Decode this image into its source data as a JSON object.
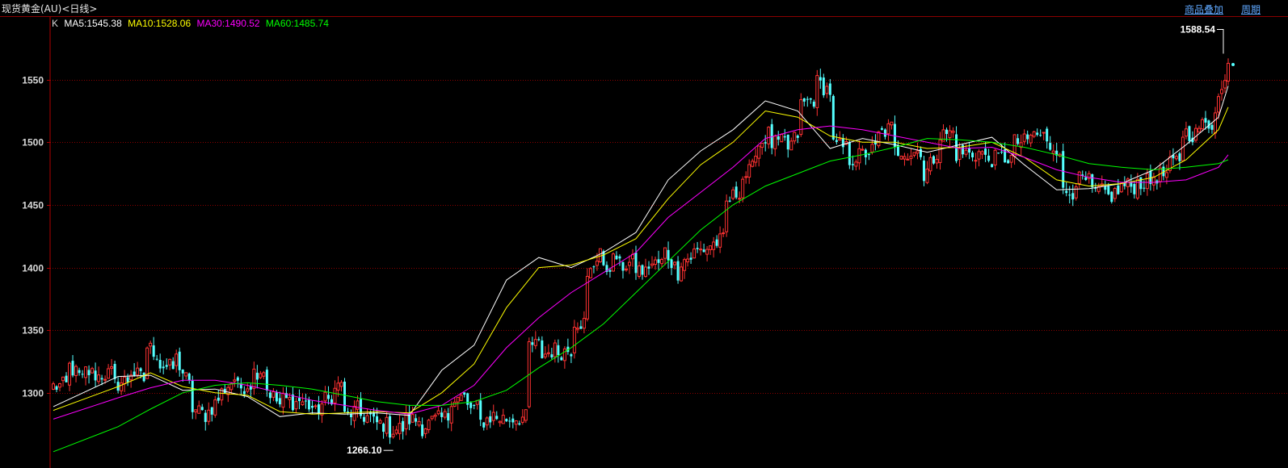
{
  "window": {
    "title": "现货黄金(AU)<日线>",
    "links": [
      "商品叠加",
      "周期"
    ]
  },
  "legend": {
    "k": "K",
    "items": [
      {
        "text": "MA5:1545.38",
        "color": "#ffffff"
      },
      {
        "text": "MA10:1528.06",
        "color": "#ffff00"
      },
      {
        "text": "MA30:1490.52",
        "color": "#ff00ff"
      },
      {
        "text": "MA60:1485.74",
        "color": "#00ff00"
      }
    ]
  },
  "colors": {
    "up": "#ff3232",
    "down": "#54ffff",
    "grid": "#8b0000",
    "axis": "#b00000",
    "label": "#d8d8d8"
  },
  "chart_data": {
    "type": "candlestick",
    "ylim": [
      1240,
      1600
    ],
    "yticks": [
      1300,
      1350,
      1400,
      1450,
      1500,
      1550
    ],
    "annotations": [
      {
        "text": "1588.54",
        "kind": "high"
      },
      {
        "text": "1266.10",
        "kind": "low"
      }
    ],
    "ohlc_anchors": [
      [
        1282,
        1305
      ],
      [
        1306,
        1322
      ],
      [
        1309,
        1318
      ],
      [
        1313,
        1314
      ],
      [
        1316,
        1306
      ],
      [
        1311,
        1318
      ],
      [
        1310,
        1338
      ],
      [
        1330,
        1322
      ],
      [
        1319,
        1329
      ],
      [
        1303,
        1288
      ],
      [
        1282,
        1282
      ],
      [
        1298,
        1300
      ],
      [
        1313,
        1303
      ],
      [
        1308,
        1316
      ],
      [
        1320,
        1303
      ],
      [
        1288,
        1295
      ],
      [
        1292,
        1295
      ],
      [
        1288,
        1280
      ],
      [
        1298,
        1293
      ],
      [
        1312,
        1280
      ],
      [
        1287,
        1282
      ],
      [
        1280,
        1276
      ],
      [
        1274,
        1270
      ],
      [
        1272,
        1279
      ],
      [
        1278,
        1271
      ],
      [
        1278,
        1278
      ],
      [
        1281,
        1296
      ],
      [
        1296,
        1288
      ],
      [
        1288,
        1276
      ],
      [
        1283,
        1280
      ],
      [
        1279,
        1280
      ],
      [
        1280,
        1338
      ],
      [
        1338,
        1330
      ],
      [
        1335,
        1332
      ],
      [
        1335,
        1358
      ],
      [
        1355,
        1390
      ],
      [
        1420,
        1395
      ],
      [
        1410,
        1400
      ],
      [
        1404,
        1400
      ],
      [
        1395,
        1402
      ],
      [
        1404,
        1415
      ],
      [
        1395,
        1405
      ],
      [
        1409,
        1412
      ],
      [
        1416,
        1418
      ],
      [
        1422,
        1450
      ],
      [
        1462,
        1470
      ],
      [
        1480,
        1495
      ],
      [
        1508,
        1498
      ],
      [
        1500,
        1492
      ],
      [
        1510,
        1530
      ],
      [
        1535,
        1548
      ],
      [
        1540,
        1498
      ],
      [
        1495,
        1485
      ],
      [
        1490,
        1490
      ],
      [
        1495,
        1505
      ],
      [
        1512,
        1492
      ],
      [
        1495,
        1490
      ],
      [
        1495,
        1470
      ],
      [
        1495,
        1505
      ],
      [
        1508,
        1490
      ],
      [
        1492,
        1490
      ],
      [
        1492,
        1486
      ],
      [
        1487,
        1488
      ],
      [
        1487,
        1500
      ],
      [
        1500,
        1506
      ],
      [
        1505,
        1498
      ],
      [
        1495,
        1458
      ],
      [
        1462,
        1470
      ],
      [
        1468,
        1460
      ],
      [
        1460,
        1455
      ],
      [
        1462,
        1465
      ],
      [
        1465,
        1468
      ],
      [
        1468,
        1473
      ],
      [
        1474,
        1480
      ],
      [
        1488,
        1508
      ],
      [
        1506,
        1512
      ],
      [
        1515,
        1525
      ],
      [
        1553,
        1563
      ]
    ],
    "ma_anchors": {
      "MA5": [
        [
          0,
          1289
        ],
        [
          20,
          1313
        ],
        [
          30,
          1314
        ],
        [
          40,
          1302
        ],
        [
          50,
          1303
        ],
        [
          60,
          1297
        ],
        [
          70,
          1281
        ],
        [
          80,
          1284
        ],
        [
          90,
          1283
        ],
        [
          100,
          1284
        ],
        [
          110,
          1282
        ],
        [
          120,
          1318
        ],
        [
          130,
          1338
        ],
        [
          140,
          1390
        ],
        [
          150,
          1408
        ],
        [
          160,
          1400
        ],
        [
          170,
          1412
        ],
        [
          180,
          1428
        ],
        [
          190,
          1470
        ],
        [
          200,
          1493
        ],
        [
          210,
          1510
        ],
        [
          220,
          1533
        ],
        [
          230,
          1525
        ],
        [
          240,
          1495
        ],
        [
          250,
          1503
        ],
        [
          260,
          1498
        ],
        [
          270,
          1492
        ],
        [
          280,
          1498
        ],
        [
          290,
          1504
        ],
        [
          300,
          1482
        ],
        [
          310,
          1462
        ],
        [
          320,
          1463
        ],
        [
          330,
          1467
        ],
        [
          340,
          1478
        ],
        [
          350,
          1498
        ],
        [
          360,
          1520
        ],
        [
          363,
          1545
        ]
      ],
      "MA10": [
        [
          0,
          1286
        ],
        [
          20,
          1305
        ],
        [
          30,
          1316
        ],
        [
          40,
          1305
        ],
        [
          50,
          1300
        ],
        [
          60,
          1298
        ],
        [
          70,
          1285
        ],
        [
          80,
          1283
        ],
        [
          90,
          1284
        ],
        [
          100,
          1285
        ],
        [
          110,
          1284
        ],
        [
          120,
          1300
        ],
        [
          130,
          1323
        ],
        [
          140,
          1368
        ],
        [
          150,
          1400
        ],
        [
          160,
          1402
        ],
        [
          170,
          1410
        ],
        [
          180,
          1423
        ],
        [
          190,
          1455
        ],
        [
          200,
          1482
        ],
        [
          210,
          1500
        ],
        [
          220,
          1525
        ],
        [
          230,
          1520
        ],
        [
          240,
          1505
        ],
        [
          250,
          1500
        ],
        [
          260,
          1500
        ],
        [
          270,
          1495
        ],
        [
          280,
          1496
        ],
        [
          290,
          1500
        ],
        [
          300,
          1488
        ],
        [
          310,
          1470
        ],
        [
          320,
          1465
        ],
        [
          330,
          1467
        ],
        [
          340,
          1472
        ],
        [
          350,
          1486
        ],
        [
          360,
          1510
        ],
        [
          363,
          1528
        ]
      ],
      "MA30": [
        [
          0,
          1279
        ],
        [
          20,
          1296
        ],
        [
          30,
          1304
        ],
        [
          40,
          1310
        ],
        [
          50,
          1310
        ],
        [
          60,
          1306
        ],
        [
          70,
          1300
        ],
        [
          80,
          1294
        ],
        [
          90,
          1290
        ],
        [
          100,
          1286
        ],
        [
          110,
          1283
        ],
        [
          120,
          1290
        ],
        [
          130,
          1306
        ],
        [
          140,
          1336
        ],
        [
          150,
          1360
        ],
        [
          160,
          1380
        ],
        [
          170,
          1396
        ],
        [
          180,
          1412
        ],
        [
          190,
          1440
        ],
        [
          200,
          1460
        ],
        [
          210,
          1480
        ],
        [
          220,
          1503
        ],
        [
          230,
          1510
        ],
        [
          240,
          1513
        ],
        [
          250,
          1510
        ],
        [
          260,
          1505
        ],
        [
          270,
          1500
        ],
        [
          280,
          1495
        ],
        [
          290,
          1496
        ],
        [
          300,
          1488
        ],
        [
          310,
          1478
        ],
        [
          320,
          1472
        ],
        [
          330,
          1468
        ],
        [
          340,
          1468
        ],
        [
          350,
          1470
        ],
        [
          360,
          1480
        ],
        [
          363,
          1490
        ]
      ],
      "MA60": [
        [
          0,
          1253
        ],
        [
          20,
          1273
        ],
        [
          30,
          1287
        ],
        [
          40,
          1300
        ],
        [
          50,
          1306
        ],
        [
          60,
          1308
        ],
        [
          70,
          1306
        ],
        [
          80,
          1303
        ],
        [
          90,
          1298
        ],
        [
          100,
          1293
        ],
        [
          110,
          1290
        ],
        [
          120,
          1290
        ],
        [
          130,
          1293
        ],
        [
          140,
          1302
        ],
        [
          150,
          1320
        ],
        [
          160,
          1336
        ],
        [
          170,
          1355
        ],
        [
          180,
          1380
        ],
        [
          190,
          1405
        ],
        [
          200,
          1430
        ],
        [
          210,
          1450
        ],
        [
          220,
          1465
        ],
        [
          230,
          1475
        ],
        [
          240,
          1485
        ],
        [
          250,
          1490
        ],
        [
          260,
          1496
        ],
        [
          270,
          1503
        ],
        [
          280,
          1502
        ],
        [
          290,
          1500
        ],
        [
          300,
          1496
        ],
        [
          310,
          1490
        ],
        [
          320,
          1483
        ],
        [
          330,
          1480
        ],
        [
          340,
          1478
        ],
        [
          350,
          1480
        ],
        [
          360,
          1483
        ],
        [
          363,
          1486
        ]
      ]
    },
    "count": 364
  }
}
